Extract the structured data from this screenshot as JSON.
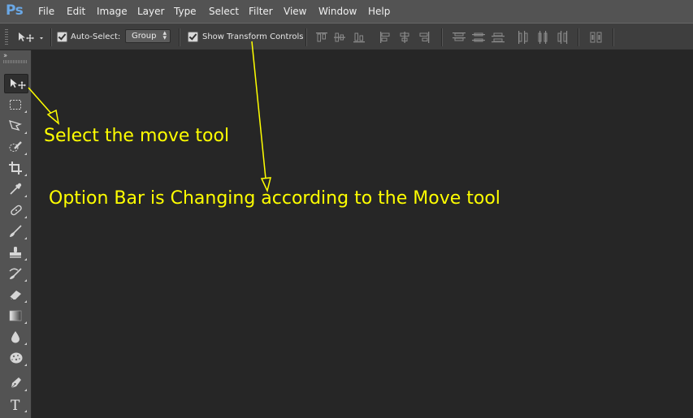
{
  "app": {
    "logo": "Ps",
    "menu": [
      "File",
      "Edit",
      "Image",
      "Layer",
      "Type",
      "Select",
      "Filter",
      "View",
      "Window",
      "Help"
    ]
  },
  "options_bar": {
    "auto_select_label": "Auto-Select:",
    "auto_select_checked": true,
    "auto_select_target": "Group",
    "show_transform_label": "Show Transform Controls",
    "show_transform_checked": true
  },
  "tools": [
    "move-tool",
    "marquee-tool",
    "lasso-tool",
    "quick-selection-tool",
    "crop-tool",
    "eyedropper-tool",
    "spot-healing-tool",
    "brush-tool",
    "clone-stamp-tool",
    "history-brush-tool",
    "eraser-tool",
    "gradient-tool",
    "blur-tool",
    "dodge-tool",
    "pen-tool",
    "type-tool"
  ],
  "annotations": {
    "move_tool_note": "Select the move tool",
    "option_bar_note": "Option Bar is Changing according to the Move tool"
  },
  "colors": {
    "annotation": "#ffff00",
    "canvas": "#262626",
    "menubar": "#535353",
    "optionsbar": "#3e3e3e"
  }
}
